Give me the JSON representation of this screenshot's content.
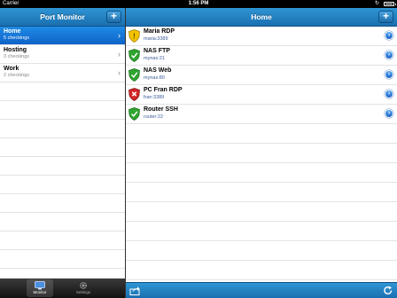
{
  "status_bar": {
    "carrier": "Carrier",
    "time": "1:56 PM"
  },
  "master": {
    "title": "Port Monitor",
    "add_label": "+",
    "groups": [
      {
        "name": "Home",
        "count": "5 checkings",
        "selected": true
      },
      {
        "name": "Hosting",
        "count": "3 checkings",
        "selected": false
      },
      {
        "name": "Work",
        "count": "2 checkings",
        "selected": false
      }
    ]
  },
  "tabs": [
    {
      "label": "Monitor",
      "icon": "monitor-icon",
      "active": true
    },
    {
      "label": "Settings",
      "icon": "gear-icon",
      "active": false
    }
  ],
  "detail": {
    "title": "Home",
    "add_label": "+",
    "hosts": [
      {
        "name": "Maria RDP",
        "address": "maria:3389",
        "status": "warning"
      },
      {
        "name": "NAS FTP",
        "address": "mynas:21",
        "status": "ok"
      },
      {
        "name": "NAS Web",
        "address": "mynas:80",
        "status": "ok"
      },
      {
        "name": "PC Fran RDP",
        "address": "fran:3389",
        "status": "error"
      },
      {
        "name": "Router SSH",
        "address": "router:22",
        "status": "ok"
      }
    ]
  },
  "colors": {
    "nav_blue": "#1a6fb0",
    "selection_blue": "#0f62c9",
    "status_ok": "#2fa52f",
    "status_warning": "#f2c200",
    "status_error": "#d32626"
  }
}
